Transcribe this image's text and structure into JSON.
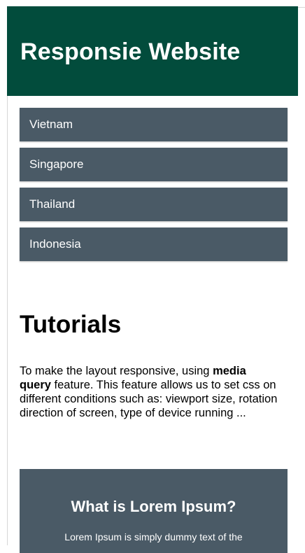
{
  "header": {
    "title": "Responsie Website"
  },
  "menu": {
    "items": [
      {
        "label": "Vietnam"
      },
      {
        "label": "Singapore"
      },
      {
        "label": "Thailand"
      },
      {
        "label": "Indonesia"
      }
    ]
  },
  "tutorials": {
    "title": "Tutorials",
    "text_before": "To make the layout responsive, using ",
    "bold": "media query",
    "text_after": " feature. This feature allows us to set css on different conditions such as: viewport size, rotation direction of screen, type of device running ..."
  },
  "lorem": {
    "title": "What is Lorem Ipsum?",
    "text": "Lorem Ipsum is simply dummy text of the"
  },
  "colors": {
    "header_bg": "#024c3c",
    "menu_bg": "#4a5a66",
    "text": "#000000"
  }
}
